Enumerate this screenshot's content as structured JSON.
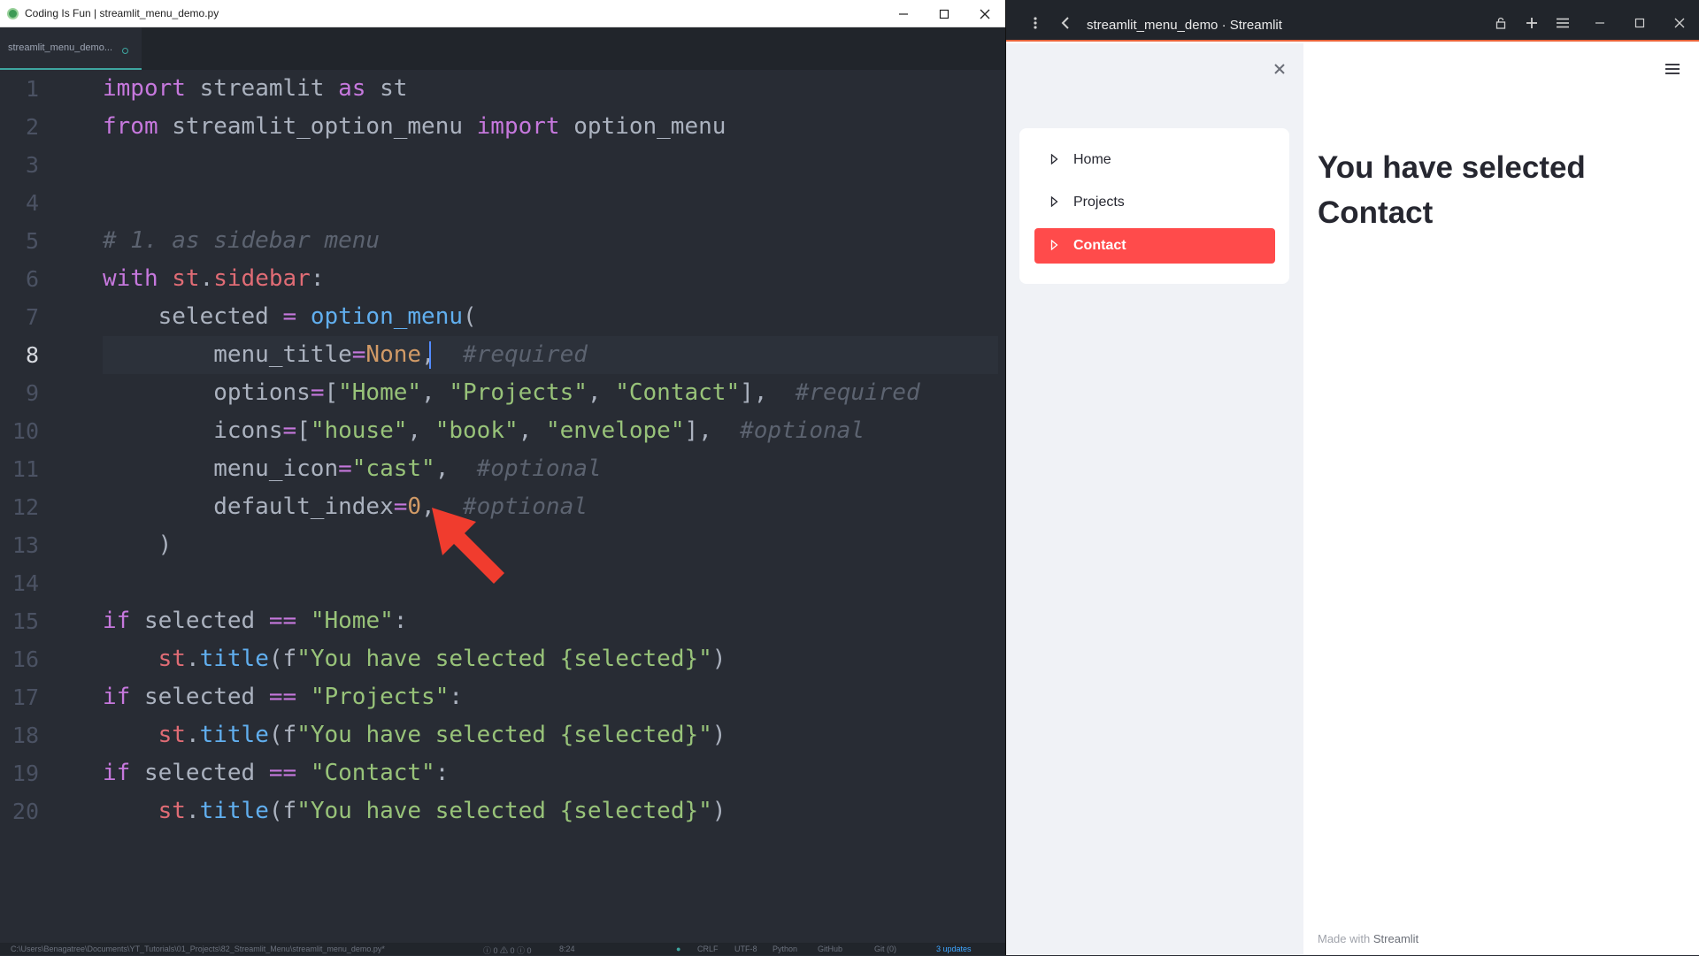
{
  "editor": {
    "window_title": "Coding Is Fun | streamlit_menu_demo.py",
    "tab_label": "streamlit_menu_demo...",
    "line_numbers": [
      "1",
      "2",
      "3",
      "4",
      "5",
      "6",
      "7",
      "8",
      "9",
      "10",
      "11",
      "12",
      "13",
      "14",
      "15",
      "16",
      "17",
      "18",
      "19",
      "20"
    ],
    "active_line": 8,
    "code": {
      "l1": [
        "import",
        " streamlit ",
        "as",
        " st"
      ],
      "l2": [
        "from",
        " streamlit_option_menu ",
        "import",
        " option_menu"
      ],
      "l5": "# 1. as sidebar menu",
      "l6": [
        "with",
        " ",
        "st",
        ".",
        "sidebar",
        ":"
      ],
      "l7": [
        "    selected ",
        "=",
        " ",
        "option_menu",
        "("
      ],
      "l8": [
        "        menu_title",
        "=",
        "None",
        ",  ",
        "#required"
      ],
      "l9": [
        "        options",
        "=",
        "[",
        "\"Home\"",
        ", ",
        "\"Projects\"",
        ", ",
        "\"Contact\"",
        "],  ",
        "#required"
      ],
      "l10": [
        "        icons",
        "=",
        "[",
        "\"house\"",
        ", ",
        "\"book\"",
        ", ",
        "\"envelope\"",
        "],  ",
        "#optional"
      ],
      "l11": [
        "        menu_icon",
        "=",
        "\"cast\"",
        ",  ",
        "#optional"
      ],
      "l12": [
        "        default_index",
        "=",
        "0",
        ",  ",
        "#optional"
      ],
      "l13": "    )",
      "l15": [
        "if",
        " selected ",
        "==",
        " ",
        "\"Home\"",
        ":"
      ],
      "l16": [
        "    ",
        "st",
        ".",
        "title",
        "(f",
        "\"You have selected {selected}\"",
        ")"
      ],
      "l17": [
        "if",
        " selected ",
        "==",
        " ",
        "\"Projects\"",
        ":"
      ],
      "l18": [
        "    ",
        "st",
        ".",
        "title",
        "(f",
        "\"You have selected {selected}\"",
        ")"
      ],
      "l19": [
        "if",
        " selected ",
        "==",
        " ",
        "\"Contact\"",
        ":"
      ],
      "l20": [
        "    ",
        "st",
        ".",
        "title",
        "(f",
        "\"You have selected {selected}\"",
        ")"
      ]
    },
    "status": {
      "path": "C:\\Users\\Benagatree\\Documents\\YT_Tutorials\\01_Projects\\82_Streamlit_Menu\\streamlit_menu_demo.py*",
      "diagnostics": "ⓘ 0 ⚠ 0 ⓘ 0",
      "cursor": "8:24",
      "line_ending": "CRLF",
      "encoding": "UTF-8",
      "grammar": "Python",
      "github": "GitHub",
      "git": "Git (0)",
      "updates": "3 updates"
    }
  },
  "browser": {
    "window_title": "streamlit_menu_demo · Streamlit",
    "sidebar": {
      "menu_items": [
        "Home",
        "Projects",
        "Contact"
      ],
      "selected_index": 2
    },
    "main": {
      "heading": "You have selected Contact",
      "footer_prefix": "Made with",
      "footer_brand": "Streamlit"
    }
  },
  "colors": {
    "editor_bg": "#282c34",
    "keyword": "#c678dd",
    "string": "#98c379",
    "number": "#d19a66",
    "comment": "#5c6370",
    "function": "#61afef",
    "variable": "#e06c75",
    "accent": "#ff4b4b",
    "arrow": "#f03c2e"
  }
}
